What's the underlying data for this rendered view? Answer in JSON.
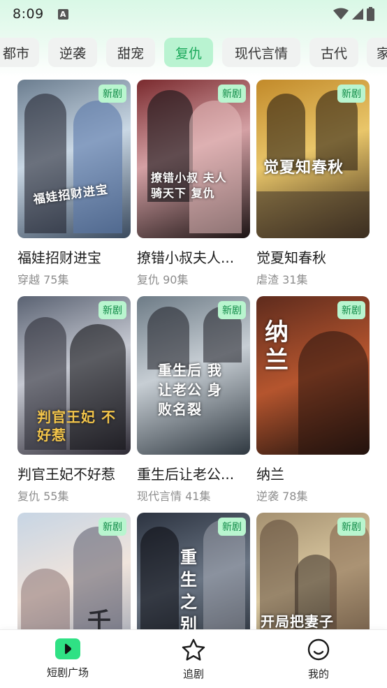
{
  "status": {
    "time": "8:09",
    "a_icon": "A"
  },
  "tabs": [
    {
      "label": "都市",
      "active": false
    },
    {
      "label": "逆袭",
      "active": false
    },
    {
      "label": "甜宠",
      "active": false
    },
    {
      "label": "复仇",
      "active": true
    },
    {
      "label": "现代言情",
      "active": false
    },
    {
      "label": "古代",
      "active": false
    },
    {
      "label": "家",
      "active": false
    }
  ],
  "badge_label": "新剧",
  "dramas": [
    {
      "title": "福娃招财进宝",
      "meta": "穿越 75集",
      "poster_text": "福娃招财进宝",
      "colors": [
        "#6b7d8f",
        "#c9d7e4",
        "#3a4a5e"
      ]
    },
    {
      "title": "撩错小叔夫人...",
      "meta": "复仇 90集",
      "poster_text": "撩错小叔 夫人骑天下 复仇",
      "colors": [
        "#7a2a2e",
        "#d4a0a4",
        "#1c1414"
      ]
    },
    {
      "title": "觉夏知春秋",
      "meta": "虐渣 31集",
      "poster_text": "觉夏知春秋",
      "colors": [
        "#c28a2a",
        "#e9c66a",
        "#3b2a18"
      ]
    },
    {
      "title": "判官王妃不好惹",
      "meta": "复仇 55集",
      "poster_text": "判官王妃 不好惹",
      "colors": [
        "#5a6272",
        "#c6c9d2",
        "#2d2a34"
      ]
    },
    {
      "title": "重生后让老公...",
      "meta": "现代言情 41集",
      "poster_text": "重生后 我让老公 身败名裂",
      "colors": [
        "#6d7b86",
        "#c7ced4",
        "#2f3840"
      ]
    },
    {
      "title": "纳兰",
      "meta": "逆袭 78集",
      "poster_text": "纳兰",
      "colors": [
        "#5e2b1d",
        "#b5552e",
        "#1d110d"
      ]
    },
    {
      "title": "",
      "meta": "",
      "poster_text": "千",
      "colors": [
        "#c7d5e4",
        "#f0e4dc",
        "#8c96a8"
      ]
    },
    {
      "title": "",
      "meta": "",
      "poster_text": "重生之 别错意",
      "colors": [
        "#2c3340",
        "#6a7584",
        "#151a22"
      ]
    },
    {
      "title": "",
      "meta": "",
      "poster_text": "开局把妻子",
      "colors": [
        "#a49070",
        "#dccaa2",
        "#4e4536"
      ]
    }
  ],
  "bottom_nav": [
    {
      "label": "短剧广场",
      "icon": "play-square-icon",
      "active": true
    },
    {
      "label": "追剧",
      "icon": "star-icon",
      "active": false
    },
    {
      "label": "我的",
      "icon": "smile-face-icon",
      "active": false
    }
  ]
}
